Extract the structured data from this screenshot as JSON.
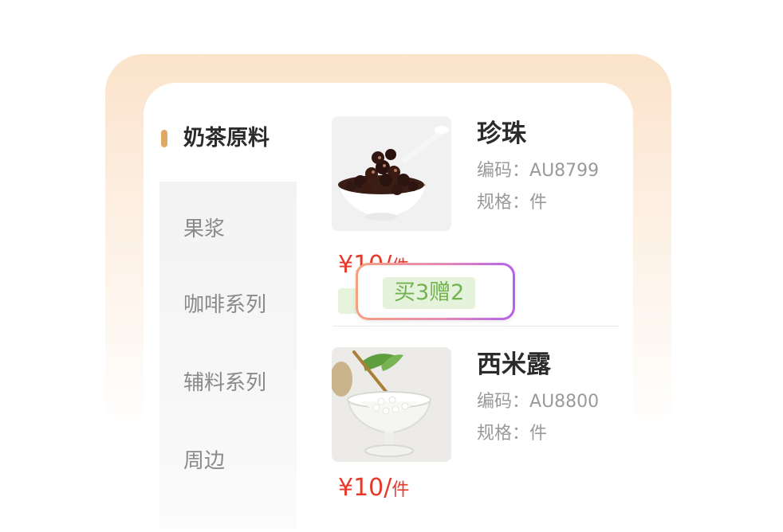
{
  "sidebar": {
    "active_category": "奶茶原料",
    "categories": [
      "果浆",
      "咖啡系列",
      "辅料系列",
      "周边"
    ]
  },
  "products": [
    {
      "name": "珍珠",
      "code_label": "编码：",
      "code": "AU8799",
      "spec_label": "规格：",
      "spec": "件",
      "price": "¥10/",
      "unit": "件",
      "image_icon": "tapioca-pearls-bowl"
    },
    {
      "name": "西米露",
      "code_label": "编码：",
      "code": "AU8800",
      "spec_label": "规格：",
      "spec": "件",
      "price": "¥10/",
      "unit": "件",
      "image_icon": "sago-dessert-glass"
    }
  ],
  "promo": {
    "label": "买3赠2"
  },
  "colors": {
    "accent": "#e0a862",
    "price": "#e5392a",
    "promo_text": "#72b24f",
    "promo_bg": "#e5f3dc"
  }
}
